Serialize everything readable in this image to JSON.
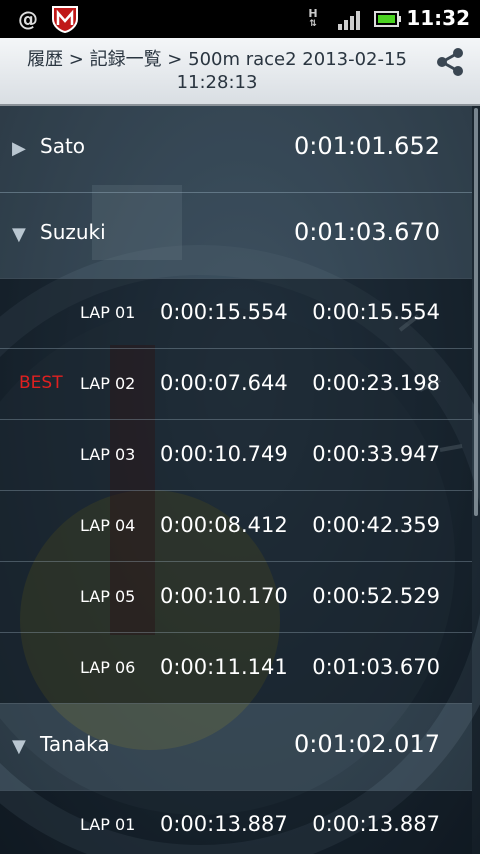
{
  "status_bar": {
    "left_icons": [
      "at-icon",
      "mcafee-icon"
    ],
    "right_icons": [
      "hsdpa-icon",
      "signal-icon",
      "battery-icon"
    ],
    "hsdpa_label": "H",
    "time": "11:32"
  },
  "header": {
    "breadcrumb": "履歴 > 記録一覧 > 500m  race2 2013-02-15 11:28:13",
    "share_icon": "share-icon"
  },
  "racers": [
    {
      "name": "Sato",
      "total": "0:01:01.652",
      "expanded": false
    },
    {
      "name": "Suzuki",
      "total": "0:01:03.670",
      "expanded": true
    },
    {
      "name": "Tanaka",
      "total": "0:01:02.017",
      "expanded": true
    }
  ],
  "suzuki_laps": [
    {
      "badge": "",
      "lap": "LAP 01",
      "split": "0:00:15.554",
      "cumulative": "0:00:15.554"
    },
    {
      "badge": "BEST",
      "lap": "LAP 02",
      "split": "0:00:07.644",
      "cumulative": "0:00:23.198"
    },
    {
      "badge": "",
      "lap": "LAP 03",
      "split": "0:00:10.749",
      "cumulative": "0:00:33.947"
    },
    {
      "badge": "",
      "lap": "LAP 04",
      "split": "0:00:08.412",
      "cumulative": "0:00:42.359"
    },
    {
      "badge": "",
      "lap": "LAP 05",
      "split": "0:00:10.170",
      "cumulative": "0:00:52.529"
    },
    {
      "badge": "",
      "lap": "LAP 06",
      "split": "0:00:11.141",
      "cumulative": "0:01:03.670"
    }
  ],
  "tanaka_laps": [
    {
      "badge": "",
      "lap": "LAP 01",
      "split": "0:00:13.887",
      "cumulative": "0:00:13.887"
    }
  ],
  "icons": {
    "expanded": "▼",
    "collapsed": "▶"
  },
  "colors": {
    "best_badge": "#e02020",
    "header_bg": "#e8ecef"
  }
}
